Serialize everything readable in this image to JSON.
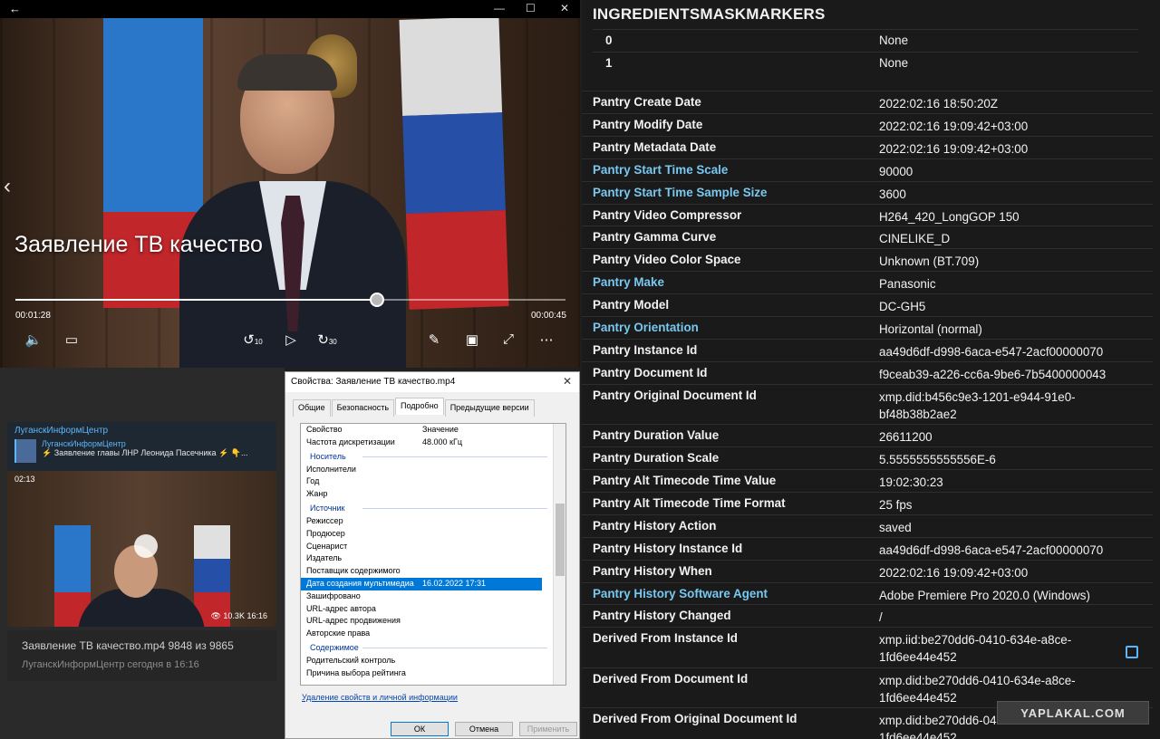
{
  "player": {
    "title": "Заявление ТВ качество",
    "elapsed": "00:01:28",
    "remaining": "00:00:45",
    "progress": 0.657,
    "skip_back": "10",
    "skip_forward": "30"
  },
  "telegram": {
    "channel": "ЛуганскИнформЦентр",
    "quote_name": "ЛуганскИнформЦентр",
    "quote_text": "⚡ Заявление главы ЛНР Леонида Пасечника ⚡ 👇...",
    "duration": "02:13",
    "views": "10.3K",
    "time": "16:16",
    "file_name": "Заявление ТВ качество.mp4 9848 из 9865",
    "file_meta": "ЛуганскИнформЦентр   сегодня в 16:16"
  },
  "dialog": {
    "title": "Свойства: Заявление ТВ качество.mp4",
    "tabs": [
      "Общие",
      "Безопасность",
      "Подробно",
      "Предыдущие версии"
    ],
    "header": {
      "name": "Свойство",
      "value": "Значение"
    },
    "rows": [
      {
        "type": "row",
        "name": "Частота дискретизации",
        "value": "48.000 кГц"
      },
      {
        "type": "group",
        "name": "Носитель"
      },
      {
        "type": "row",
        "name": "Исполнители",
        "value": ""
      },
      {
        "type": "row",
        "name": "Год",
        "value": ""
      },
      {
        "type": "row",
        "name": "Жанр",
        "value": ""
      },
      {
        "type": "group",
        "name": "Источник"
      },
      {
        "type": "row",
        "name": "Режиссер",
        "value": ""
      },
      {
        "type": "row",
        "name": "Продюсер",
        "value": ""
      },
      {
        "type": "row",
        "name": "Сценарист",
        "value": ""
      },
      {
        "type": "row",
        "name": "Издатель",
        "value": ""
      },
      {
        "type": "row",
        "name": "Поставщик содержимого",
        "value": ""
      },
      {
        "type": "row",
        "name": "Дата создания мультимедиа",
        "value": "16.02.2022 17:31",
        "selected": true
      },
      {
        "type": "row",
        "name": "Зашифровано",
        "value": ""
      },
      {
        "type": "row",
        "name": "URL-адрес автора",
        "value": ""
      },
      {
        "type": "row",
        "name": "URL-адрес продвижения",
        "value": ""
      },
      {
        "type": "row",
        "name": "Авторские права",
        "value": ""
      },
      {
        "type": "group",
        "name": "Содержимое"
      },
      {
        "type": "row",
        "name": "Родительский контроль",
        "value": ""
      },
      {
        "type": "row",
        "name": "Причина выбора рейтинга",
        "value": ""
      }
    ],
    "link": "Удаление свойств и личной информации",
    "ok": "ОК",
    "cancel": "Отмена",
    "apply": "Применить"
  },
  "metadata": {
    "heading": "INGREDIENTSMASKMARKERS",
    "index_rows": [
      {
        "index": "0",
        "value": "None"
      },
      {
        "index": "1",
        "value": "None"
      }
    ],
    "rows": [
      {
        "key": "Pantry Create Date",
        "value": "2022:02:16 18:50:20Z",
        "blue": false
      },
      {
        "key": "Pantry Modify Date",
        "value": "2022:02:16 19:09:42+03:00",
        "blue": false
      },
      {
        "key": "Pantry Metadata Date",
        "value": "2022:02:16 19:09:42+03:00",
        "blue": false
      },
      {
        "key": "Pantry Start Time Scale",
        "value": "90000",
        "blue": true
      },
      {
        "key": "Pantry Start Time Sample Size",
        "value": "3600",
        "blue": true
      },
      {
        "key": "Pantry Video Compressor",
        "value": "H264_420_LongGOP 150",
        "blue": false
      },
      {
        "key": "Pantry Gamma Curve",
        "value": "CINELIKE_D",
        "blue": false
      },
      {
        "key": "Pantry Video Color Space",
        "value": "Unknown (BT.709)",
        "blue": false
      },
      {
        "key": "Pantry Make",
        "value": "Panasonic",
        "blue": true
      },
      {
        "key": "Pantry Model",
        "value": "DC-GH5",
        "blue": false
      },
      {
        "key": "Pantry Orientation",
        "value": "Horizontal (normal)",
        "blue": true
      },
      {
        "key": "Pantry Instance Id",
        "value": "aa49d6df-d998-6aca-e547-2acf00000070",
        "blue": false
      },
      {
        "key": "Pantry Document Id",
        "value": "f9ceab39-a226-cc6a-9be6-7b5400000043",
        "blue": false
      },
      {
        "key": "Pantry Original Document Id",
        "value": "xmp.did:b456c9e3-1201-e944-91e0-\nbf48b38b2ae2",
        "blue": false
      },
      {
        "key": "Pantry Duration Value",
        "value": "26611200",
        "blue": false
      },
      {
        "key": "Pantry Duration Scale",
        "value": "5.5555555555556E-6",
        "blue": false
      },
      {
        "key": "Pantry Alt Timecode Time Value",
        "value": "19:02:30:23",
        "blue": false
      },
      {
        "key": "Pantry Alt Timecode Time Format",
        "value": "25 fps",
        "blue": false
      },
      {
        "key": "Pantry History Action",
        "value": "saved",
        "blue": false
      },
      {
        "key": "Pantry History Instance Id",
        "value": "aa49d6df-d998-6aca-e547-2acf00000070",
        "blue": false
      },
      {
        "key": "Pantry History When",
        "value": "2022:02:16 19:09:42+03:00",
        "blue": false
      },
      {
        "key": "Pantry History Software Agent",
        "value": "Adobe Premiere Pro 2020.0 (Windows)",
        "blue": true
      },
      {
        "key": "Pantry History Changed",
        "value": "/",
        "blue": false
      },
      {
        "key": "Derived From Instance Id",
        "value": "xmp.iid:be270dd6-0410-634e-a8ce-\n1fd6ee44e452",
        "blue": false
      },
      {
        "key": "Derived From Document Id",
        "value": "xmp.did:be270dd6-0410-634e-a8ce-\n1fd6ee44e452",
        "blue": false
      },
      {
        "key": "Derived From Original Document Id",
        "value": "xmp.did:be270dd6-0410-634e-a8ce-\n1fd6ee44e452",
        "blue": false
      }
    ]
  },
  "watermark": "YAPLAKAL.COM",
  "colors": {
    "accent_blue": "#78c8f0",
    "selection": "#0078d7",
    "link": "#0645ad"
  }
}
